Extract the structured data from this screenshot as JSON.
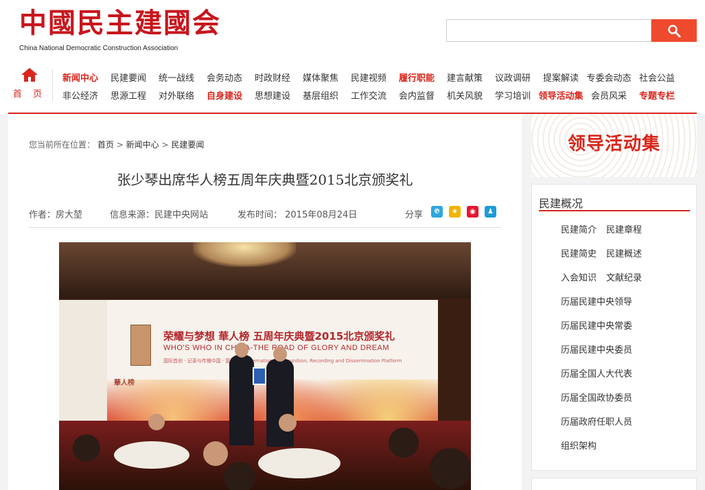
{
  "site": {
    "logo_cn": "中國民主建國会",
    "logo_en": "China National Democratic Construction Association"
  },
  "search": {
    "placeholder": "",
    "value": ""
  },
  "home": {
    "label": "首 页"
  },
  "nav": {
    "row1": [
      {
        "label": "新闻中心",
        "hl": true
      },
      {
        "label": "民建要闻",
        "hl": false
      },
      {
        "label": "统一战线",
        "hl": false
      },
      {
        "label": "会务动态",
        "hl": false
      },
      {
        "label": "时政财经",
        "hl": false
      },
      {
        "label": "媒体聚焦",
        "hl": false
      },
      {
        "label": "民建视频",
        "hl": false
      },
      {
        "label": "履行职能",
        "hl": true
      },
      {
        "label": "建言献策",
        "hl": false
      },
      {
        "label": "议政调研",
        "hl": false
      },
      {
        "label": "提案解读",
        "hl": false
      },
      {
        "label": "专委会动态",
        "hl": false
      },
      {
        "label": "社会公益",
        "hl": false
      }
    ],
    "row2": [
      {
        "label": "非公经济",
        "hl": false
      },
      {
        "label": "思源工程",
        "hl": false
      },
      {
        "label": "对外联络",
        "hl": false
      },
      {
        "label": "自身建设",
        "hl": true
      },
      {
        "label": "思想建设",
        "hl": false
      },
      {
        "label": "基层组织",
        "hl": false
      },
      {
        "label": "工作交流",
        "hl": false
      },
      {
        "label": "会内监督",
        "hl": false
      },
      {
        "label": "机关风貌",
        "hl": false
      },
      {
        "label": "学习培训",
        "hl": false
      },
      {
        "label": "领导活动集",
        "hl": true
      },
      {
        "label": "会员风采",
        "hl": false
      },
      {
        "label": "专题专栏",
        "hl": true
      }
    ]
  },
  "breadcrumb": {
    "prefix": "您当前所在位置：",
    "items": [
      "首页",
      "新闻中心",
      "民建要闻"
    ],
    "sep": ">"
  },
  "article": {
    "title": "张少琴出席华人榜五周年庆典暨2015北京颁奖礼",
    "author": "作者：房大堃",
    "source": "信息来源：民建中央网站",
    "date": "发布时间： 2015年08月24日",
    "share_label": "分享",
    "photo": {
      "screen_title": "荣耀与梦想 華人榜 五周年庆典暨2015北京颁奖礼",
      "screen_sub": "WHO'S WHO IN CHINA-THE ROAD OF GLORY AND DREAM",
      "screen_sub2": "国际首创 · 记录与传播中国 · 国际认证 International Recognition, Recording and Dissemination Platform",
      "brand_small": "華人榜"
    }
  },
  "share_icons": [
    {
      "name": "share-icon-1",
      "glyph": "℗",
      "color": "#2fa6e0"
    },
    {
      "name": "qzone-icon",
      "glyph": "★",
      "color": "#f2b400"
    },
    {
      "name": "weibo-icon",
      "glyph": "◉",
      "color": "#e6162d"
    },
    {
      "name": "qq-icon",
      "glyph": "♟",
      "color": "#1d9bd7"
    }
  ],
  "sidebar": {
    "banner": "领导活动集",
    "box_title": "民建概况",
    "rows": [
      [
        "民建简介",
        "民建章程"
      ],
      [
        "民建简史",
        "民建概述"
      ],
      [
        "入会知识",
        "文献纪录"
      ],
      [
        "历届民建中央领导"
      ],
      [
        "历届民建中央常委"
      ],
      [
        "历届民建中央委员"
      ],
      [
        "历届全国人大代表"
      ],
      [
        "历届全国政协委员"
      ],
      [
        "历届政府任职人员"
      ],
      [
        "组织架构"
      ]
    ]
  },
  "colors": {
    "brand_red": "#d9261c",
    "search_btn": "#ef4a2e"
  }
}
